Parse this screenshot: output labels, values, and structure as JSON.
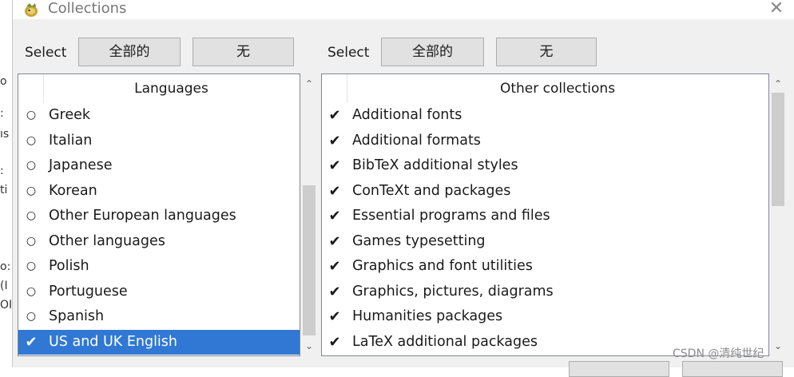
{
  "window": {
    "title": "Collections",
    "close_glyph": "✕",
    "app_icon": "app-icon"
  },
  "background_fragments": [
    "o",
    ":",
    "ıs",
    ":",
    "ti",
    "o:",
    "(I",
    "OI"
  ],
  "left": {
    "select_label": "Select",
    "all_button": "全部的",
    "none_button": "无",
    "header": "Languages",
    "items": [
      {
        "mark": "○",
        "label": "Greek",
        "selected": false
      },
      {
        "mark": "○",
        "label": "Italian",
        "selected": false
      },
      {
        "mark": "○",
        "label": "Japanese",
        "selected": false
      },
      {
        "mark": "○",
        "label": "Korean",
        "selected": false
      },
      {
        "mark": "○",
        "label": "Other European languages",
        "selected": false
      },
      {
        "mark": "○",
        "label": "Other languages",
        "selected": false
      },
      {
        "mark": "○",
        "label": "Polish",
        "selected": false
      },
      {
        "mark": "○",
        "label": "Portuguese",
        "selected": false
      },
      {
        "mark": "○",
        "label": "Spanish",
        "selected": false
      },
      {
        "mark": "✔",
        "label": "US and UK English",
        "selected": true
      }
    ],
    "scroll_up": "⌃",
    "scroll_down": "⌄"
  },
  "right": {
    "select_label": "Select",
    "all_button": "全部的",
    "none_button": "无",
    "header": "Other collections",
    "items": [
      {
        "mark": "✔",
        "label": "Additional fonts"
      },
      {
        "mark": "✔",
        "label": "Additional formats"
      },
      {
        "mark": "✔",
        "label": "BibTeX additional styles"
      },
      {
        "mark": "✔",
        "label": "ConTeXt and packages"
      },
      {
        "mark": "✔",
        "label": "Essential programs and files"
      },
      {
        "mark": "✔",
        "label": "Games typesetting"
      },
      {
        "mark": "✔",
        "label": "Graphics and font utilities"
      },
      {
        "mark": "✔",
        "label": "Graphics, pictures, diagrams"
      },
      {
        "mark": "✔",
        "label": "Humanities packages"
      },
      {
        "mark": "✔",
        "label": "LaTeX additional packages"
      }
    ],
    "scroll_up": "⌃",
    "scroll_down": "⌄"
  },
  "watermark": "CSDN @清纯世纪",
  "colors": {
    "selection": "#3178d4",
    "button_face": "#e1e1e1",
    "dialog_bg": "#f0f0f0"
  }
}
